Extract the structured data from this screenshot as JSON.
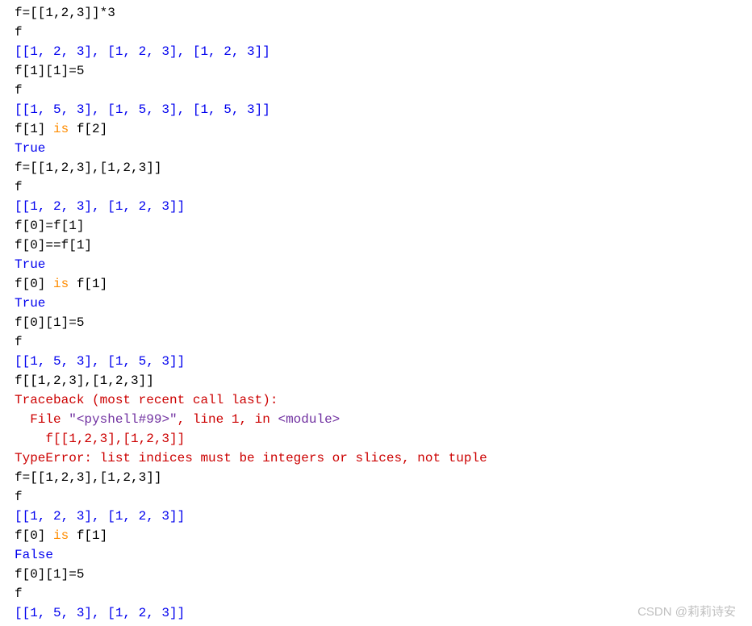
{
  "lines": [
    {
      "type": "input",
      "spans": [
        {
          "t": "f=[[1,2,3]]*3",
          "c": ""
        }
      ]
    },
    {
      "type": "input",
      "spans": [
        {
          "t": "f",
          "c": ""
        }
      ]
    },
    {
      "type": "output",
      "spans": [
        {
          "t": "[[1, 2, 3], [1, 2, 3], [1, 2, 3]]",
          "c": "out-blue"
        }
      ]
    },
    {
      "type": "input",
      "spans": [
        {
          "t": "f[1][1]=5",
          "c": ""
        }
      ]
    },
    {
      "type": "input",
      "spans": [
        {
          "t": "f",
          "c": ""
        }
      ]
    },
    {
      "type": "output",
      "spans": [
        {
          "t": "[[1, 5, 3], [1, 5, 3], [1, 5, 3]]",
          "c": "out-blue"
        }
      ]
    },
    {
      "type": "input",
      "spans": [
        {
          "t": "f[1] ",
          "c": ""
        },
        {
          "t": "is",
          "c": "kw"
        },
        {
          "t": " f[2]",
          "c": ""
        }
      ]
    },
    {
      "type": "output",
      "spans": [
        {
          "t": "True",
          "c": "out-blue"
        }
      ]
    },
    {
      "type": "input",
      "spans": [
        {
          "t": "f=[[1,2,3],[1,2,3]]",
          "c": ""
        }
      ]
    },
    {
      "type": "input",
      "spans": [
        {
          "t": "f",
          "c": ""
        }
      ]
    },
    {
      "type": "output",
      "spans": [
        {
          "t": "[[1, 2, 3], [1, 2, 3]]",
          "c": "out-blue"
        }
      ]
    },
    {
      "type": "input",
      "spans": [
        {
          "t": "f[0]=f[1]",
          "c": ""
        }
      ]
    },
    {
      "type": "input",
      "spans": [
        {
          "t": "f[0]==f[1]",
          "c": ""
        }
      ]
    },
    {
      "type": "output",
      "spans": [
        {
          "t": "True",
          "c": "out-blue"
        }
      ]
    },
    {
      "type": "input",
      "spans": [
        {
          "t": "f[0] ",
          "c": ""
        },
        {
          "t": "is",
          "c": "kw"
        },
        {
          "t": " f[1]",
          "c": ""
        }
      ]
    },
    {
      "type": "output",
      "spans": [
        {
          "t": "True",
          "c": "out-blue"
        }
      ]
    },
    {
      "type": "input",
      "spans": [
        {
          "t": "f[0][1]=5",
          "c": ""
        }
      ]
    },
    {
      "type": "input",
      "spans": [
        {
          "t": "f",
          "c": ""
        }
      ]
    },
    {
      "type": "output",
      "spans": [
        {
          "t": "[[1, 5, 3], [1, 5, 3]]",
          "c": "out-blue"
        }
      ]
    },
    {
      "type": "input",
      "spans": [
        {
          "t": "f[[1,2,3],[1,2,3]]",
          "c": ""
        }
      ]
    },
    {
      "type": "output",
      "spans": [
        {
          "t": "Traceback (most recent call last):",
          "c": "err-red"
        }
      ]
    },
    {
      "type": "output",
      "spans": [
        {
          "t": "  File ",
          "c": "err-red"
        },
        {
          "t": "\"<pyshell#99>\"",
          "c": "mod-purple"
        },
        {
          "t": ", line 1, in ",
          "c": "err-red"
        },
        {
          "t": "<module>",
          "c": "mod-purple"
        }
      ]
    },
    {
      "type": "output",
      "spans": [
        {
          "t": "    f[[1,2,3],[1,2,3]]",
          "c": "err-red"
        }
      ]
    },
    {
      "type": "output",
      "spans": [
        {
          "t": "TypeError",
          "c": "err-red"
        },
        {
          "t": ": list indices must be integers or slices, not tuple",
          "c": "err-red"
        }
      ]
    },
    {
      "type": "input",
      "spans": [
        {
          "t": "f=[[1,2,3],[1,2,3]]",
          "c": ""
        }
      ]
    },
    {
      "type": "input",
      "spans": [
        {
          "t": "f",
          "c": ""
        }
      ]
    },
    {
      "type": "output",
      "spans": [
        {
          "t": "[[1, 2, 3], [1, 2, 3]]",
          "c": "out-blue"
        }
      ]
    },
    {
      "type": "input",
      "spans": [
        {
          "t": "f[0] ",
          "c": ""
        },
        {
          "t": "is",
          "c": "kw"
        },
        {
          "t": " f[1]",
          "c": ""
        }
      ]
    },
    {
      "type": "output",
      "spans": [
        {
          "t": "False",
          "c": "out-blue"
        }
      ]
    },
    {
      "type": "input",
      "spans": [
        {
          "t": "f[0][1]=5",
          "c": ""
        }
      ]
    },
    {
      "type": "input",
      "spans": [
        {
          "t": "f",
          "c": ""
        }
      ]
    },
    {
      "type": "output",
      "spans": [
        {
          "t": "[[1, 5, 3], [1, 2, 3]]",
          "c": "out-blue"
        }
      ]
    }
  ],
  "watermark": "CSDN @莉莉诗安"
}
